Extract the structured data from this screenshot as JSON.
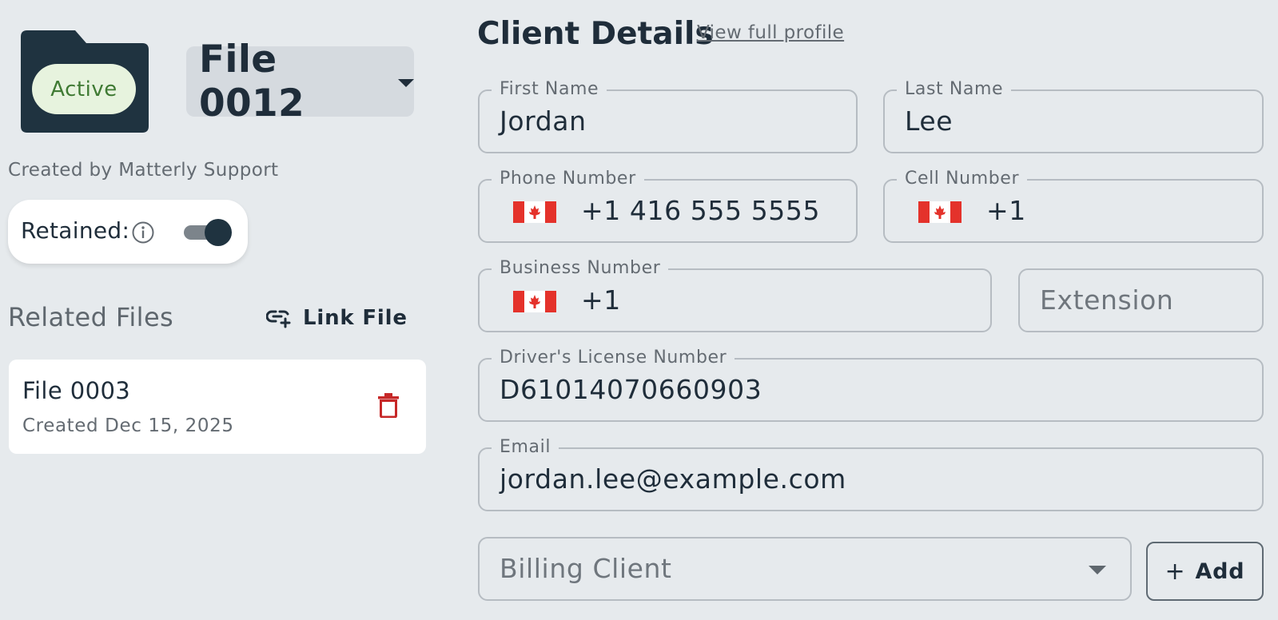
{
  "file": {
    "status": "Active",
    "selected_file": "File 0012",
    "created_by": "Created by Matterly Support"
  },
  "retained": {
    "label": "Retained:",
    "enabled": true
  },
  "related": {
    "title": "Related Files",
    "link_label": "Link File",
    "items": [
      {
        "name": "File 0003",
        "created": "Created Dec 15, 2025"
      }
    ]
  },
  "client": {
    "title": "Client Details",
    "profile_link": "View full profile",
    "first_name": {
      "label": "First Name",
      "value": "Jordan"
    },
    "last_name": {
      "label": "Last Name",
      "value": "Lee"
    },
    "phone": {
      "label": "Phone Number",
      "value": "+1 416 555 5555"
    },
    "cell": {
      "label": "Cell Number",
      "value": "+1"
    },
    "business": {
      "label": "Business Number",
      "value": "+1"
    },
    "extension": {
      "placeholder": "Extension"
    },
    "license": {
      "label": "Driver's License Number",
      "value": "D61014070660903"
    },
    "email": {
      "label": "Email",
      "value": "jordan.lee@example.com"
    },
    "billing": {
      "placeholder": "Billing Client"
    },
    "add_label": "Add"
  },
  "colors": {
    "background": "#e6eaed",
    "primary_dark": "#1f3340",
    "status_green_bg": "#e7f3de",
    "status_green_text": "#3f7a33",
    "danger": "#c62828",
    "flag_red": "#e4322b"
  },
  "icons": [
    "folder-icon",
    "chevron-down-icon",
    "info-icon",
    "link-add-icon",
    "trash-icon",
    "canada-flag-icon",
    "plus-icon"
  ]
}
